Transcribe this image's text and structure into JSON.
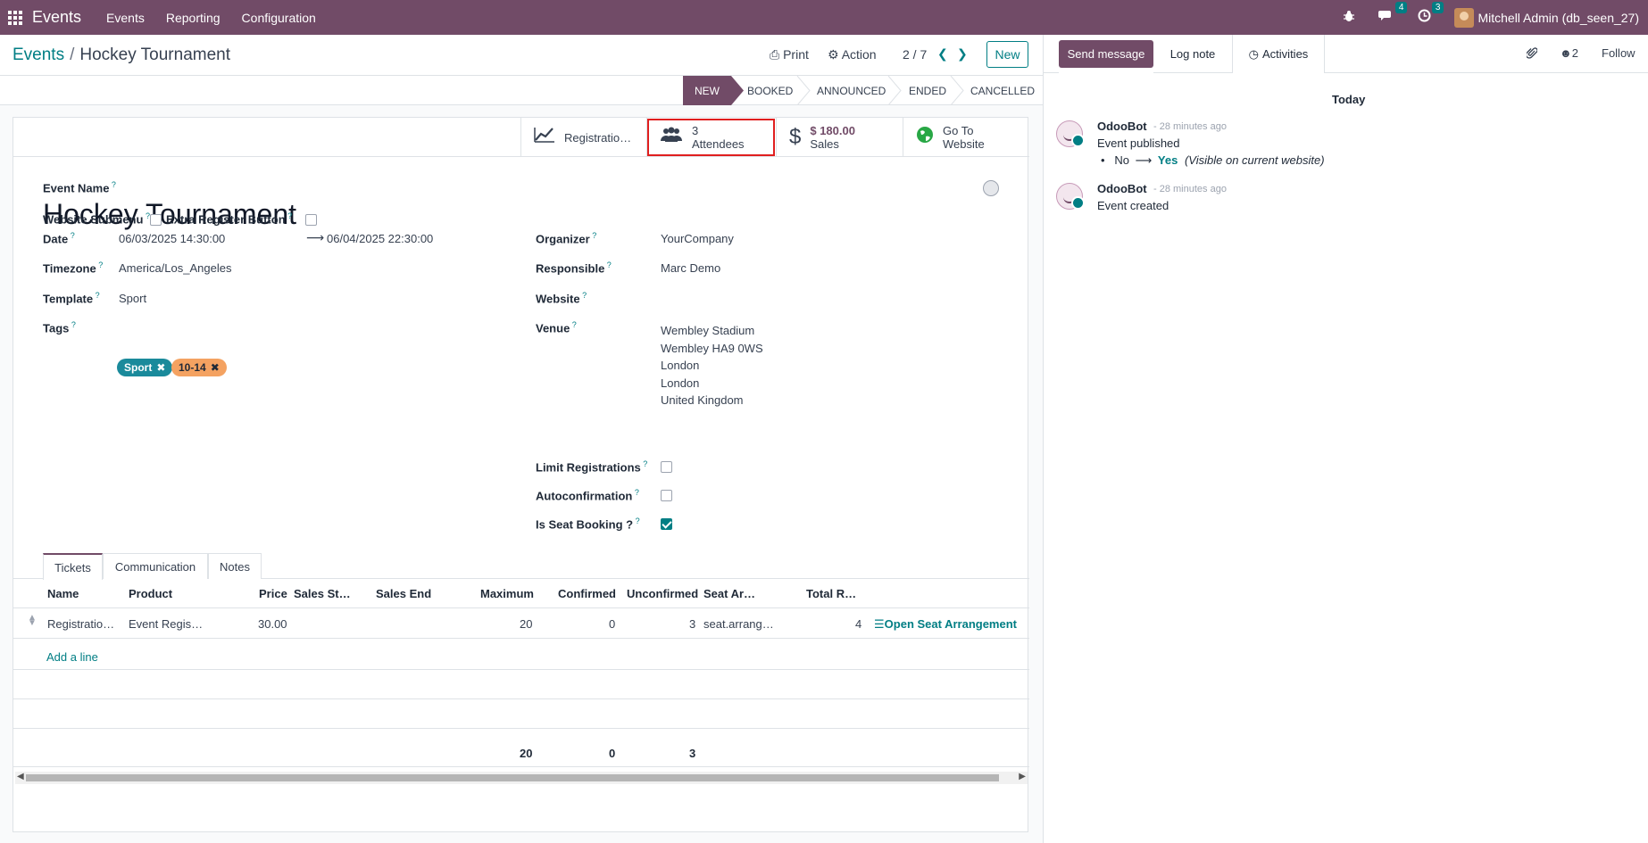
{
  "navbar": {
    "brand": "Events",
    "menus": [
      "Events",
      "Reporting",
      "Configuration"
    ],
    "chat_badge": "4",
    "activity_badge": "3",
    "user": "Mitchell Admin (db_seen_27)"
  },
  "control": {
    "breadcrumb_parent": "Events",
    "breadcrumb_current": "Hockey Tournament",
    "print": "Print",
    "action": "Action",
    "pager": "2 / 7",
    "new": "New"
  },
  "stages": [
    "NEW",
    "BOOKED",
    "ANNOUNCED",
    "ENDED",
    "CANCELLED"
  ],
  "smart_buttons": {
    "registrations": "Registratio…",
    "attendees_count": "3",
    "attendees_label": "Attendees",
    "sales_value": "$ 180.00",
    "sales_label": "Sales",
    "website_line1": "Go To",
    "website_line2": "Website"
  },
  "form": {
    "event_name_label": "Event Name",
    "event_name": "Hockey Tournament",
    "website_submenu_label": "Website Submenu",
    "extra_register_label": "Extra Register Button",
    "date_label": "Date",
    "date_start": "06/03/2025 14:30:00",
    "date_end": "06/04/2025 22:30:00",
    "timezone_label": "Timezone",
    "timezone": "America/Los_Angeles",
    "template_label": "Template",
    "template": "Sport",
    "tags_label": "Tags",
    "tags": [
      {
        "name": "Sport",
        "color": "#1a8a9b"
      },
      {
        "name": "10-14",
        "color": "#f4a261"
      }
    ],
    "organizer_label": "Organizer",
    "organizer": "YourCompany",
    "responsible_label": "Responsible",
    "responsible": "Marc Demo",
    "website_label": "Website",
    "venue_label": "Venue",
    "venue_lines": [
      "Wembley Stadium",
      "Wembley HA9 0WS",
      "London",
      "London",
      "United Kingdom"
    ],
    "limit_label": "Limit Registrations",
    "autoconfirm_label": "Autoconfirmation",
    "seat_booking_label": "Is Seat Booking ?"
  },
  "tabs": [
    "Tickets",
    "Communication",
    "Notes"
  ],
  "tickets": {
    "headers": [
      "Name",
      "Product",
      "Price",
      "Sales St…",
      "Sales End",
      "Maximum",
      "Confirmed",
      "Unconfirmed",
      "Seat Ar…",
      "Total R…"
    ],
    "row": {
      "name": "Registratio…",
      "product": "Event Regis…",
      "price": "30.00",
      "maximum": "20",
      "confirmed": "0",
      "unconfirmed": "3",
      "seat": "seat.arrang…",
      "total": "4",
      "action": "Open Seat Arrangement"
    },
    "add_line": "Add a line",
    "totals": {
      "maximum": "20",
      "confirmed": "0",
      "unconfirmed": "3"
    }
  },
  "chatter": {
    "send_message": "Send message",
    "log_note": "Log note",
    "activities": "Activities",
    "followers_count": "2",
    "follow": "Follow",
    "today": "Today",
    "messages": [
      {
        "author": "OdooBot",
        "time": "- 28 minutes ago",
        "body": "Event published",
        "change_old": "No",
        "change_new": "Yes",
        "change_note": "(Visible on current website)"
      },
      {
        "author": "OdooBot",
        "time": "- 28 minutes ago",
        "body": "Event created"
      }
    ]
  }
}
